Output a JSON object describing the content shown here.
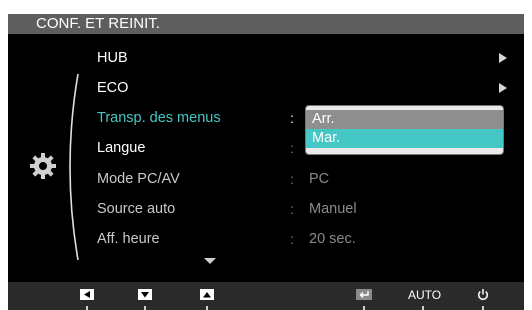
{
  "osd": {
    "title": "CONF. ET REINIT.",
    "rows": [
      {
        "label": "HUB",
        "colon": "",
        "value": "",
        "submenu": true
      },
      {
        "label": "ECO",
        "colon": "",
        "value": "",
        "submenu": true
      },
      {
        "label": "Transp. des menus",
        "colon": ":",
        "value": "",
        "submenu": false
      },
      {
        "label": "Langue",
        "colon": ":",
        "value": "",
        "submenu": false
      },
      {
        "label": "Mode PC/AV",
        "colon": ":",
        "value": "PC",
        "submenu": false
      },
      {
        "label": "Source auto",
        "colon": ":",
        "value": "Manuel",
        "submenu": false
      },
      {
        "label": "Aff. heure",
        "colon": ":",
        "value": "20 sec.",
        "submenu": false
      }
    ],
    "dropdown": {
      "options": [
        "Arr.",
        "Mar."
      ],
      "selected": "Mar."
    },
    "colors": {
      "accent": "#45c7c5",
      "background": "#000000",
      "titlebar": "#5e5e5e"
    }
  },
  "bottom_bar": {
    "buttons": [
      {
        "icon": "left-arrow-icon"
      },
      {
        "icon": "down-arrow-icon"
      },
      {
        "icon": "up-arrow-icon"
      },
      {
        "icon": "enter-icon"
      },
      {
        "label": "AUTO"
      },
      {
        "icon": "power-icon"
      }
    ]
  }
}
